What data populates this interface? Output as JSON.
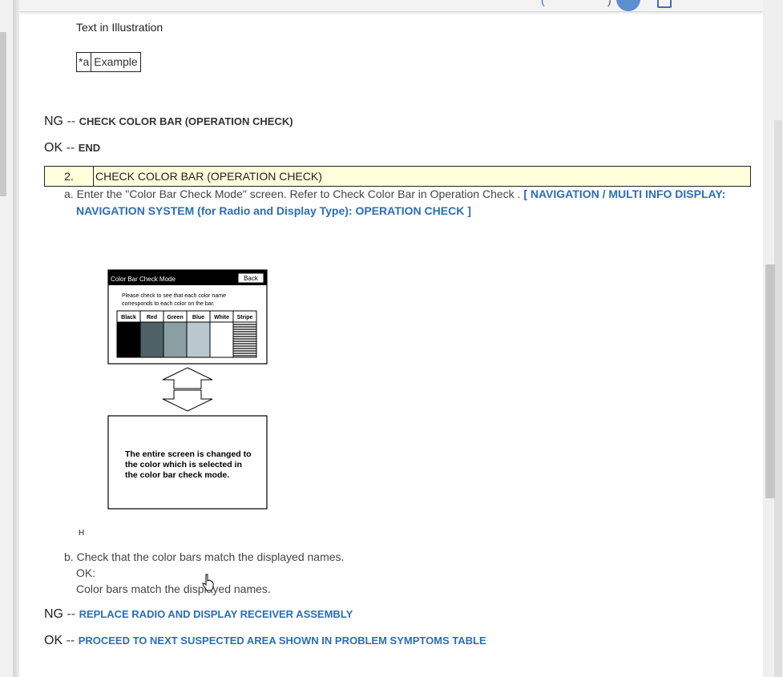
{
  "illustration_header": {
    "title": "Text in Illustration",
    "legend_key": "*a",
    "legend_value": "Example"
  },
  "result1": {
    "ng_label": "NG",
    "ng_sep": "--",
    "ng_text": "CHECK COLOR BAR (OPERATION CHECK)",
    "ok_label": "OK",
    "ok_sep": "--",
    "ok_text": "END"
  },
  "step": {
    "number": "2.",
    "title": "CHECK COLOR BAR (OPERATION CHECK)",
    "a_prefix": "a.",
    "a_text": "Enter the \"Color Bar Check Mode\" screen. Refer to Check Color Bar in Operation Check .",
    "a_link_line1": "[ NAVIGATION / MULTI INFO DISPLAY:",
    "a_link_line2": "NAVIGATION SYSTEM (for Radio and Display Type): OPERATION CHECK ]",
    "b_prefix": "b.",
    "b_text": "Check that the color bars match the displayed names.",
    "ok_label": "OK:",
    "ok_text": "Color bars match the displayed names."
  },
  "figure": {
    "screen_title": "Color Bar Check Mode",
    "back_label": "Back",
    "instruction_line1": "Please check to see that each color name",
    "instruction_line2": "corresponds to each color on the bar.",
    "columns": [
      "Black",
      "Red",
      "Green",
      "Blue",
      "White",
      "Stripe"
    ],
    "column_colors": [
      "#000000",
      "#4d6166",
      "#8a9ea3",
      "#b9c8ce",
      "#ffffff",
      "stripe"
    ],
    "result_line1": "The entire screen is changed to",
    "result_line2": "the color which is selected in",
    "result_line3": "the color bar check mode.",
    "figure_code": "H"
  },
  "result2": {
    "ng_label": "NG",
    "ng_sep": "--",
    "ng_text": "REPLACE RADIO AND DISPLAY RECEIVER ASSEMBLY",
    "ok_label": "OK",
    "ok_sep": "--",
    "ok_text": "PROCEED TO NEXT SUSPECTED AREA SHOWN IN PROBLEM SYMPTOMS TABLE"
  },
  "colors": {
    "link": "#2c6db5",
    "step_bg": "#ffffdc"
  }
}
